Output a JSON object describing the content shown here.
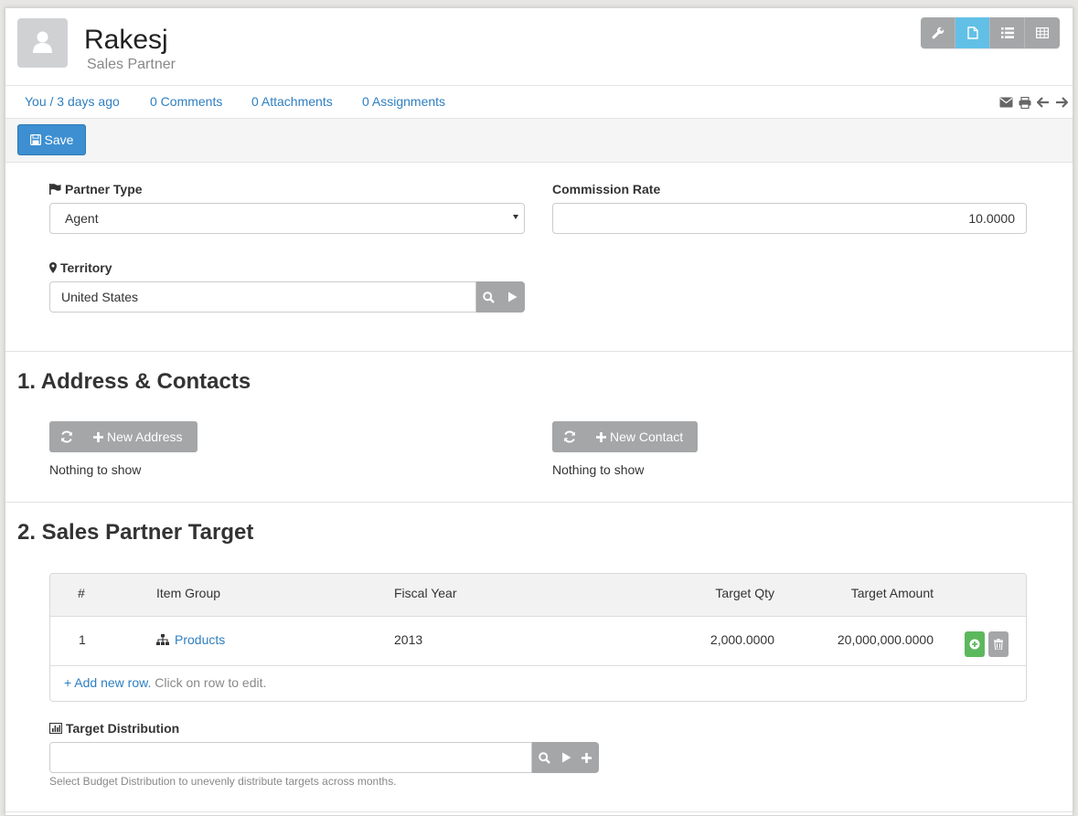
{
  "header": {
    "title": "Rakesj",
    "subtitle": "Sales Partner",
    "view_buttons": [
      "wrench-icon",
      "doc-icon",
      "list-icon",
      "table-icon"
    ],
    "active_view": "doc-icon"
  },
  "meta": {
    "owner": "You / 3 days ago",
    "comments": "0 Comments",
    "attachments": "0 Attachments",
    "assignments": "0 Assignments"
  },
  "toolbar": {
    "save_label": "Save"
  },
  "form": {
    "partner_type_label": "Partner Type",
    "partner_type_value": "Agent",
    "commission_rate_label": "Commission Rate",
    "commission_rate_value": "10.0000",
    "territory_label": "Territory",
    "territory_value": "United States"
  },
  "section1": {
    "title": "1. Address & Contacts",
    "new_address": "New Address",
    "new_contact": "New Contact",
    "address_empty": "Nothing to show",
    "contact_empty": "Nothing to show"
  },
  "section2": {
    "title": "2. Sales Partner Target",
    "columns": [
      "#",
      "Item Group",
      "Fiscal Year",
      "Target Qty",
      "Target Amount"
    ],
    "rows": [
      {
        "idx": "1",
        "item_group": "Products",
        "fiscal_year": "2013",
        "target_qty": "2,000.0000",
        "target_amount": "20,000,000.0000"
      }
    ],
    "add_row": "+ Add new row.",
    "add_row_hint": " Click on row to edit.",
    "distribution_label": "Target Distribution",
    "distribution_value": "",
    "distribution_help": "Select Budget Distribution to unevenly distribute targets across months."
  },
  "colors": {
    "link": "#2e7fc1",
    "primary": "#3d8fd1",
    "active_view": "#62c0e6",
    "grey_button": "#a4a6a8",
    "add_green": "#5cb85c"
  }
}
